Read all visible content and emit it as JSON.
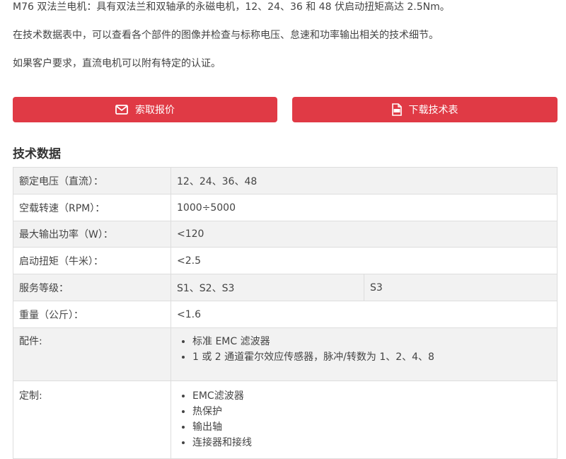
{
  "intro": [
    "M76 双法兰电机：具有双法兰和双轴承的永磁电机，12、24、36 和 48 伏启动扭矩高达 2.5Nm。",
    "在技术数据表中，可以查看各个部件的图像并检查与标称电压、怠速和功率输出相关的技术细节。",
    "如果客户要求，直流电机可以附有特定的认证。"
  ],
  "buttons": {
    "quote_label": "索取报价",
    "datasheet_label": "下载技术表"
  },
  "section_title": "技术数据",
  "specs": {
    "voltage": {
      "label": "额定电压（直流）：",
      "value": "12、24、36、48"
    },
    "speed": {
      "label": "空载转速（RPM）：",
      "value": "1000÷5000"
    },
    "power": {
      "label": "最大输出功率（W）：",
      "value": "<120"
    },
    "torque": {
      "label": "启动扭矩（牛米）：",
      "value": "<2.5"
    },
    "duty": {
      "label": "服务等级：",
      "value": "S1、S2、S3",
      "extra": "S3"
    },
    "weight": {
      "label": "重量（公斤）：",
      "value": "<1.6"
    },
    "accessories": {
      "label": "配件:",
      "items": [
        "标准 EMC 滤波器",
        "1 或 2 通道霍尔效应传感器，脉冲/转数为 1、2、4、8"
      ]
    },
    "custom": {
      "label": "定制:",
      "items": [
        "EMC滤波器",
        "热保护",
        "输出轴",
        "连接器和接线"
      ]
    }
  },
  "colors": {
    "accent": "#e03a45",
    "row_alt": "#f2f2f2",
    "border": "#dddddd"
  },
  "icons": {
    "quote": "envelope-icon",
    "datasheet": "pdf-file-icon"
  }
}
